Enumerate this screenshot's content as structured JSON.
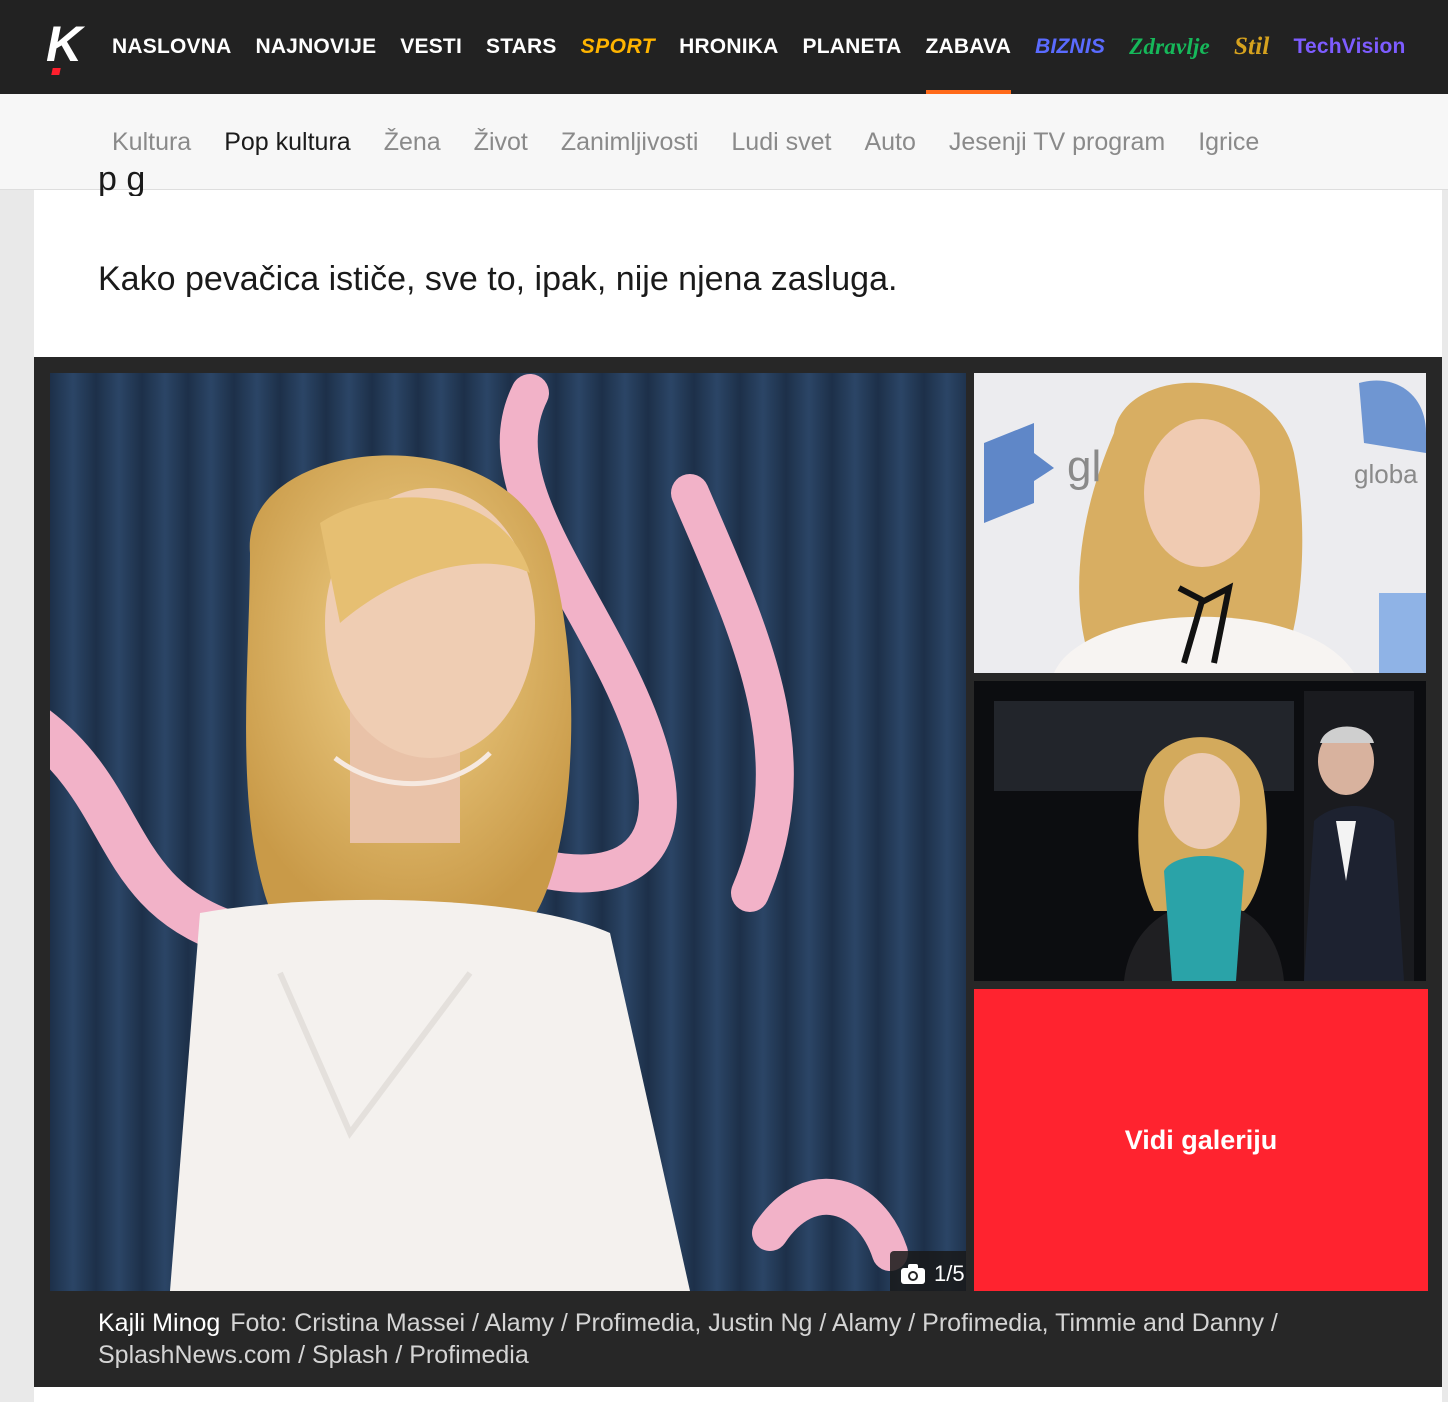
{
  "logo": {
    "letter": "K"
  },
  "nav": {
    "items": [
      {
        "label": "NASLOVNA",
        "style": "normal"
      },
      {
        "label": "NAJNOVIJE",
        "style": "normal"
      },
      {
        "label": "VESTI",
        "style": "normal"
      },
      {
        "label": "STARS",
        "style": "normal"
      },
      {
        "label": "SPORT",
        "style": "sport"
      },
      {
        "label": "HRONIKA",
        "style": "normal"
      },
      {
        "label": "PLANETA",
        "style": "normal"
      },
      {
        "label": "ZABAVA",
        "style": "normal",
        "active": true
      },
      {
        "label": "BIZNIS",
        "style": "biznis"
      },
      {
        "label": "Zdravlje",
        "style": "zdravlje"
      },
      {
        "label": "Stil",
        "style": "stil"
      },
      {
        "label": "TechVision",
        "style": "tech"
      }
    ],
    "active_underline_color": "#ff6a1a"
  },
  "subnav": {
    "items": [
      {
        "label": "Kultura"
      },
      {
        "label": "Pop kultura",
        "active": true
      },
      {
        "label": "Žena"
      },
      {
        "label": "Život"
      },
      {
        "label": "Zanimljivosti"
      },
      {
        "label": "Ludi svet"
      },
      {
        "label": "Auto"
      },
      {
        "label": "Jesenji TV program"
      },
      {
        "label": "Igrice"
      }
    ]
  },
  "article": {
    "cut_text": "p      g",
    "paragraph": "Kako pevačica ističe, sve to, ipak, nije njena zasluga."
  },
  "gallery": {
    "counter": "1/5",
    "cta_label": "Vidi galeriju",
    "cta_color": "#ff232f",
    "caption_name": "Kajli Minog",
    "caption_credit": "Foto: Cristina Massei / Alamy / Profimedia, Justin Ng / Alamy / Profimedia, Timmie and Danny / SplashNews.com / Splash / Profimedia",
    "top_photo_sign": "globa",
    "top_photo_sign_left": "gl"
  }
}
